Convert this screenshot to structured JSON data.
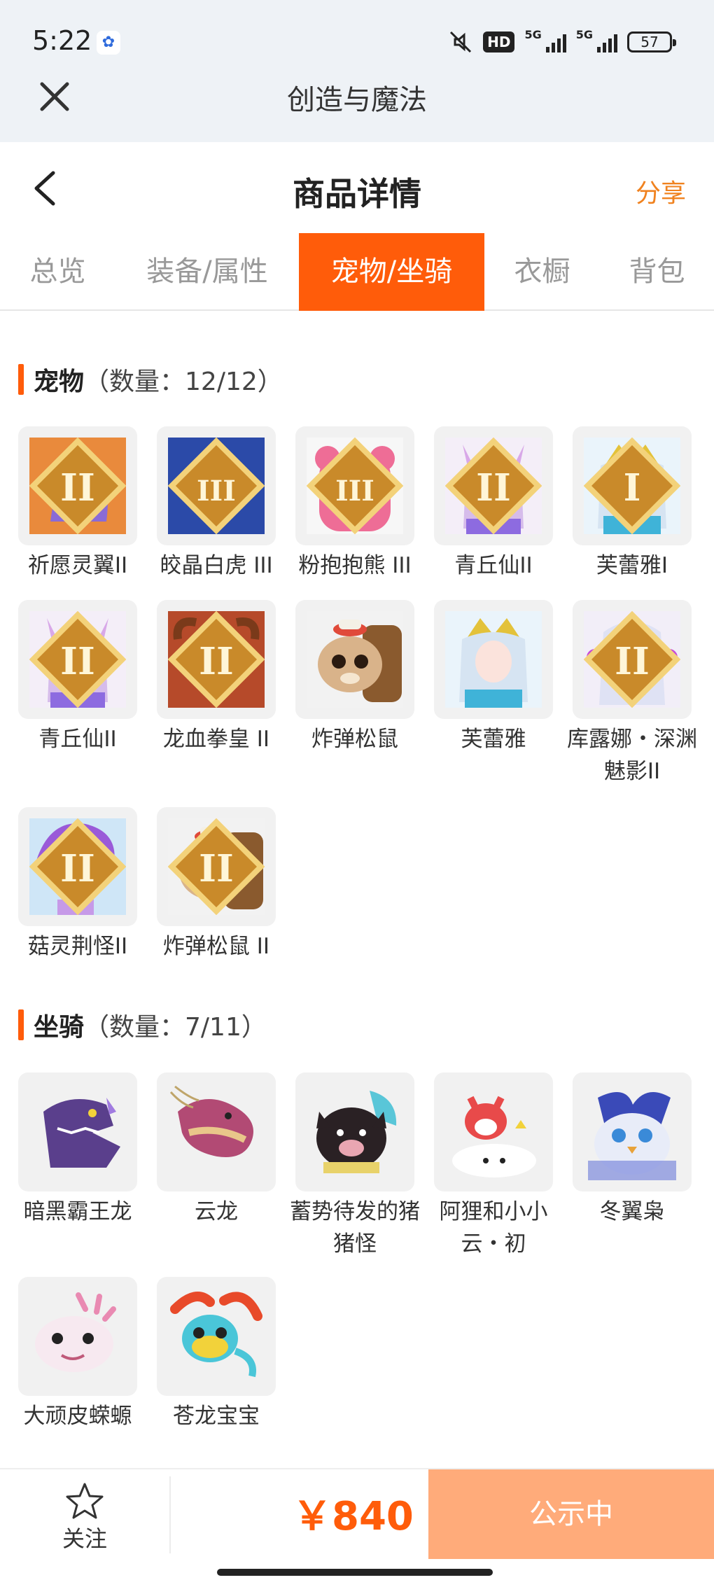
{
  "status_bar": {
    "time": "5:22",
    "battery": "57",
    "network_1": "5G",
    "network_2": "5G",
    "hd_label": "HD"
  },
  "webview": {
    "title": "创造与魔法"
  },
  "header": {
    "title": "商品详情",
    "share_label": "分享"
  },
  "tabs": [
    {
      "label": "总览",
      "active": false
    },
    {
      "label": "装备/属性",
      "active": false
    },
    {
      "label": "宠物/坐骑",
      "active": true
    },
    {
      "label": "衣橱",
      "active": false
    },
    {
      "label": "背包",
      "active": false
    }
  ],
  "pets": {
    "title": "宠物",
    "count": "（数量：12/12）",
    "items": [
      {
        "name": "祈愿灵翼II",
        "tier": "II",
        "icon": "winged-bird-icon"
      },
      {
        "name": "皎晶白虎 III",
        "tier": "III",
        "icon": "white-tiger-icon"
      },
      {
        "name": "粉抱抱熊 III",
        "tier": "III",
        "icon": "pink-bear-icon"
      },
      {
        "name": "青丘仙II",
        "tier": "II",
        "icon": "fox-fairy-icon"
      },
      {
        "name": "芙蕾雅I",
        "tier": "I",
        "icon": "crowned-maiden-icon"
      },
      {
        "name": "青丘仙II",
        "tier": "II",
        "icon": "fox-fairy-icon"
      },
      {
        "name": "龙血拳皇 II",
        "tier": "II",
        "icon": "horned-beast-icon"
      },
      {
        "name": "炸弹松鼠",
        "tier": "",
        "icon": "squirrel-icon"
      },
      {
        "name": "芙蕾雅",
        "tier": "",
        "icon": "crowned-maiden-icon"
      },
      {
        "name": "库露娜・深渊魅影II",
        "tier": "II",
        "icon": "abyss-girl-icon"
      },
      {
        "name": "菇灵荆怪II",
        "tier": "II",
        "icon": "mushroom-sprite-icon"
      },
      {
        "name": "炸弹松鼠 II",
        "tier": "II",
        "icon": "squirrel-icon"
      }
    ]
  },
  "mounts": {
    "title": "坐骑",
    "count": "（数量：7/11）",
    "items": [
      {
        "name": "暗黑霸王龙",
        "icon": "dark-trex-icon"
      },
      {
        "name": "云龙",
        "icon": "cloud-dragon-icon"
      },
      {
        "name": "蓄势待发的猪猪怪",
        "icon": "pig-monster-icon"
      },
      {
        "name": "阿狸和小小云・初",
        "icon": "ali-fox-cloud-icon"
      },
      {
        "name": "冬翼枭",
        "icon": "winter-owl-icon"
      },
      {
        "name": "大顽皮蝾螈",
        "icon": "axolotl-icon"
      },
      {
        "name": "苍龙宝宝",
        "icon": "baby-dragon-icon"
      }
    ]
  },
  "bottom_bar": {
    "follow_label": "关注",
    "price": "￥840",
    "status_label": "公示中"
  },
  "colors": {
    "accent": "#ff5c0a",
    "share": "#f0821f",
    "status_button": "#ffab7a"
  }
}
